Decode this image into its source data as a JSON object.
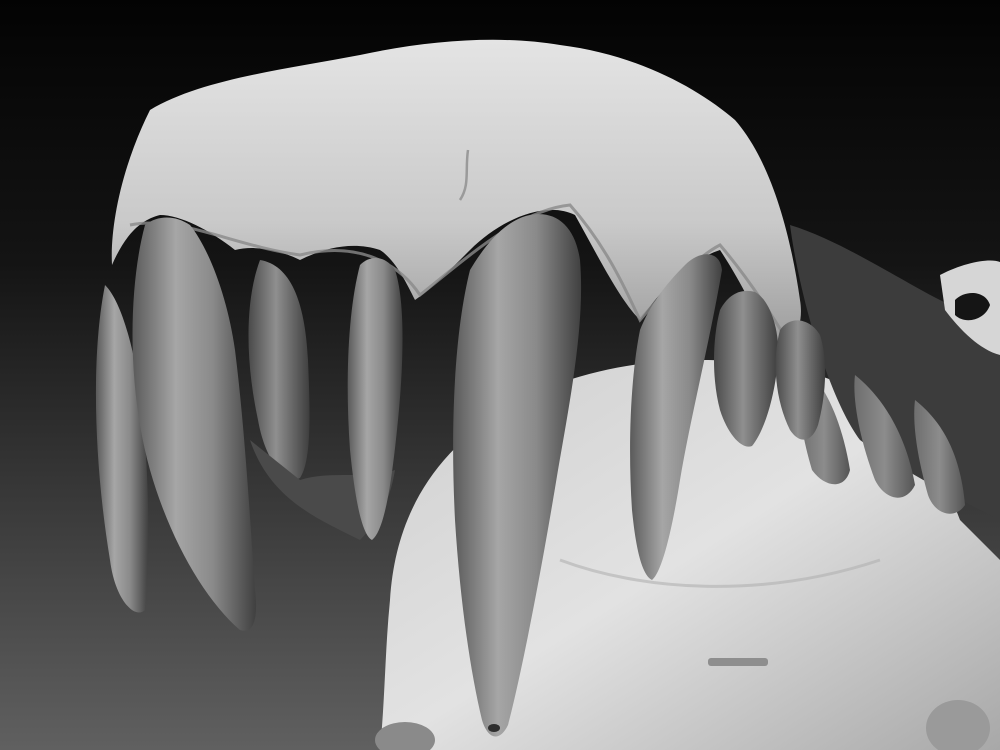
{
  "scene": {
    "subject": "sculpted-jaw-with-teeth",
    "render_style": "grayscale-clay",
    "colors": {
      "background_top": "#050505",
      "background_bottom": "#5a5a5a",
      "bone_light": "#d8d8d8",
      "bone_mid": "#a9a9a9",
      "tooth_light": "#9a9a9a",
      "tooth_dark": "#4e4e4e",
      "shadow": "#2a2a2a"
    }
  }
}
